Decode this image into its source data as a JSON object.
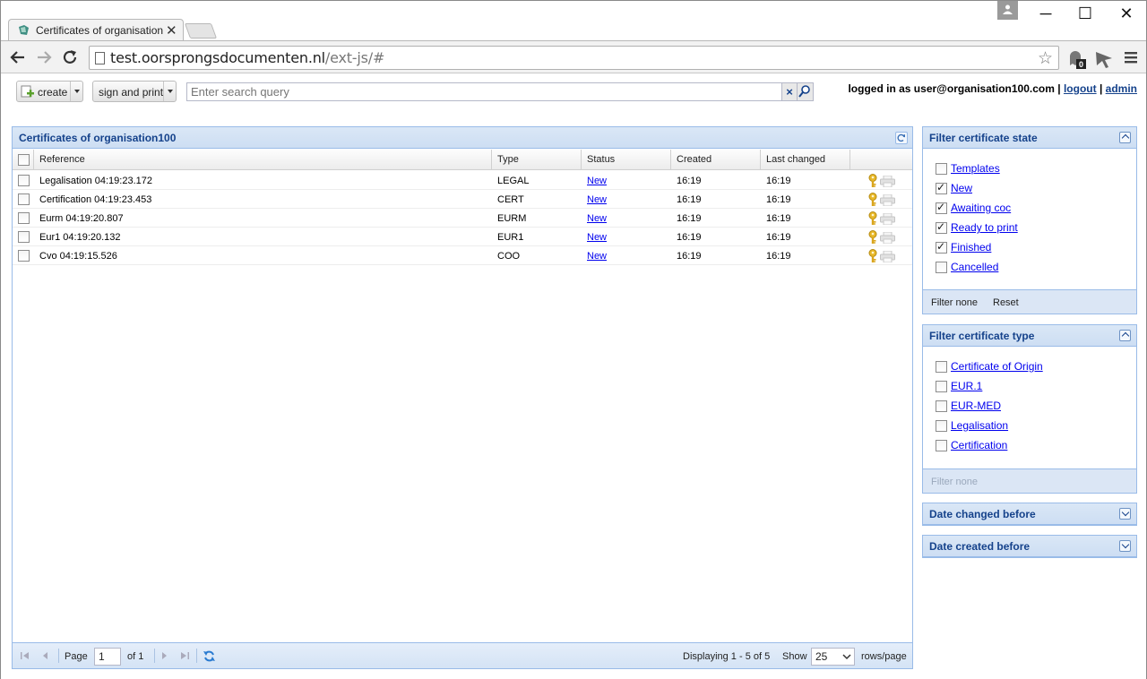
{
  "browser": {
    "tab_title": "Certificates of organisation",
    "url_host": "test.oorsprongsdocumenten.nl",
    "url_path": "/ext-js/#",
    "extension_badge": "0"
  },
  "toolbar": {
    "create_label": "create",
    "sign_print_label": "sign and print",
    "search_placeholder": "Enter search query",
    "clear_symbol": "×",
    "login_prefix": "logged in as user@organisation100.com",
    "separator": "|",
    "logout_label": "logout",
    "admin_label": "admin"
  },
  "grid": {
    "title": "Certificates of organisation100",
    "columns": [
      "Reference",
      "Type",
      "Status",
      "Created",
      "Last changed"
    ],
    "rows": [
      {
        "reference": "Legalisation 04:19:23.172",
        "type": "LEGAL",
        "status": "New",
        "created": "16:19",
        "last_changed": "16:19"
      },
      {
        "reference": "Certification 04:19:23.453",
        "type": "CERT",
        "status": "New",
        "created": "16:19",
        "last_changed": "16:19"
      },
      {
        "reference": "Eurm 04:19:20.807",
        "type": "EURM",
        "status": "New",
        "created": "16:19",
        "last_changed": "16:19"
      },
      {
        "reference": "Eur1 04:19:20.132",
        "type": "EUR1",
        "status": "New",
        "created": "16:19",
        "last_changed": "16:19"
      },
      {
        "reference": "Cvo 04:19:15.526",
        "type": "COO",
        "status": "New",
        "created": "16:19",
        "last_changed": "16:19"
      }
    ]
  },
  "paging": {
    "page_label": "Page",
    "page_value": "1",
    "of_label": "of 1",
    "displaying": "Displaying 1 - 5 of 5",
    "show_label": "Show",
    "rows_value": "25",
    "rows_suffix": "rows/page"
  },
  "filter_state": {
    "title": "Filter certificate state",
    "items": [
      {
        "label": "Templates",
        "checked": false
      },
      {
        "label": "New",
        "checked": true
      },
      {
        "label": "Awaiting coc",
        "checked": true
      },
      {
        "label": "Ready to print",
        "checked": true
      },
      {
        "label": "Finished",
        "checked": true
      },
      {
        "label": "Cancelled",
        "checked": false
      }
    ],
    "filter_none": "Filter none",
    "reset": "Reset"
  },
  "filter_type": {
    "title": "Filter certificate type",
    "items": [
      {
        "label": "Certificate of Origin",
        "checked": false
      },
      {
        "label": "EUR.1",
        "checked": false
      },
      {
        "label": "EUR-MED",
        "checked": false
      },
      {
        "label": "Legalisation",
        "checked": false
      },
      {
        "label": "Certification",
        "checked": false
      }
    ],
    "filter_none": "Filter none"
  },
  "date_changed": {
    "title": "Date changed before"
  },
  "date_created": {
    "title": "Date created before"
  },
  "colors": {
    "panel_border": "#99bbe8",
    "panel_title": "#15428b",
    "link": "#0000ee"
  }
}
